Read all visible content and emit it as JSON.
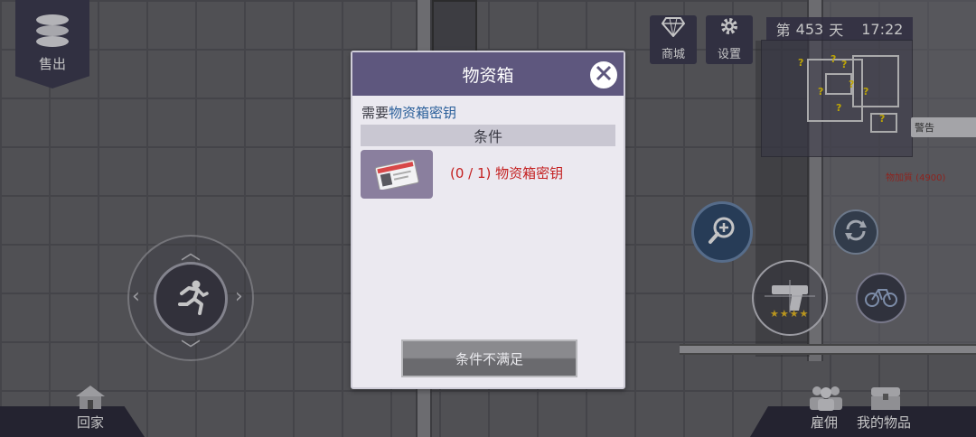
{
  "top_left": {
    "sell_label": "售出"
  },
  "top_right": {
    "shop_label": "商城",
    "settings_label": "设置",
    "day_prefix": "第",
    "day_number": "453",
    "day_suffix": "天",
    "clock": "17:22"
  },
  "minimap": {
    "alert_label": "警告",
    "loot_text": "物加質 (4900)"
  },
  "gun": {
    "stars": 4
  },
  "dialog": {
    "title": "物资箱",
    "need_prefix": "需要",
    "need_item": "物资箱密钥",
    "conditions_header": "条件",
    "requirement_progress": "(0 / 1)",
    "requirement_item": "物资箱密钥",
    "unmet_button": "条件不满足"
  },
  "bottom": {
    "home_label": "回家",
    "hire_label": "雇佣",
    "items_label": "我的物品"
  },
  "colors": {
    "dialog_header": "#5e577e",
    "requirement_text": "#c42020",
    "key_text": "#2a5f9a",
    "panel_bg": "#3b3a4f"
  }
}
